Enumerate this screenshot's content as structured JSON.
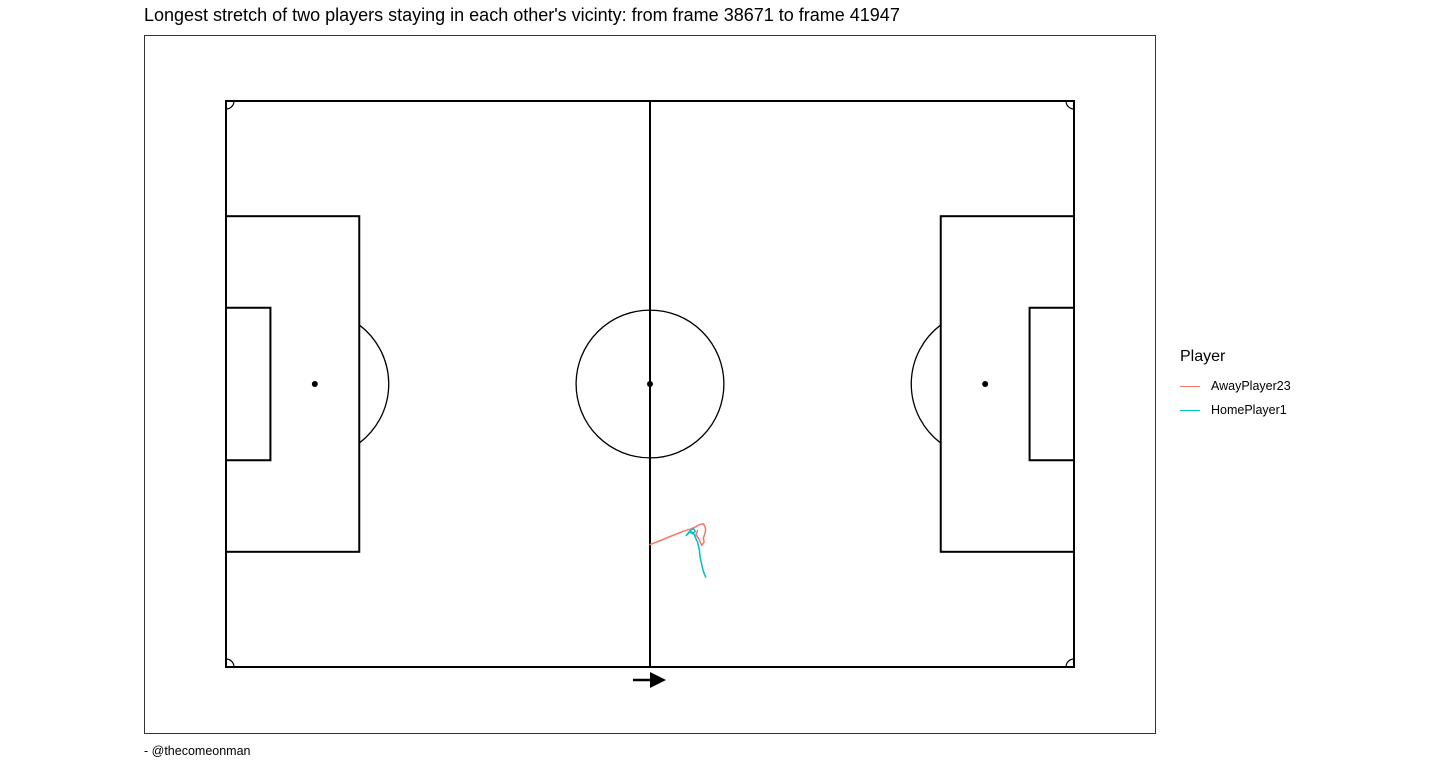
{
  "title": "Longest stretch of two players staying in each other's vicinty: from frame 38671 to frame 41947",
  "caption": "- @thecomeonman",
  "legend": {
    "title": "Player",
    "items": [
      {
        "label": "AwayPlayer23",
        "color": "#F8766D"
      },
      {
        "label": "HomePlayer1",
        "color": "#00BFC4"
      }
    ]
  },
  "chart_data": {
    "type": "line",
    "pitch": {
      "length": 105,
      "width": 68,
      "attack_direction": "right"
    },
    "xlim": [
      -10,
      115
    ],
    "ylim": [
      -8,
      76
    ],
    "grid": false,
    "legend_position": "right",
    "series": [
      {
        "name": "AwayPlayer23",
        "color": "#F8766D",
        "x": [
          52.5,
          53.8,
          55.3,
          56.6,
          57.6,
          58.3,
          58.6,
          59.1,
          59.3,
          59.4,
          59.3,
          59.1,
          59.2,
          58.9,
          58.6,
          58.2,
          58.4
        ],
        "y": [
          14.7,
          15.2,
          15.8,
          16.3,
          16.6,
          16.9,
          17.1,
          17.2,
          16.9,
          16.5,
          16.0,
          15.5,
          15.0,
          14.6,
          15.3,
          15.9,
          16.4
        ]
      },
      {
        "name": "HomePlayer1",
        "color": "#00BFC4",
        "x": [
          59.4,
          59.1,
          58.9,
          58.7,
          58.6,
          58.4,
          58.2,
          58.0,
          57.7,
          57.4,
          57.0,
          57.3,
          57.6,
          57.9,
          58.1,
          57.8,
          57.5
        ],
        "y": [
          10.8,
          11.5,
          12.3,
          13.2,
          14.1,
          15.0,
          15.4,
          15.9,
          16.2,
          16.3,
          15.8,
          16.1,
          16.5,
          16.6,
          16.3,
          16.0,
          16.2
        ]
      }
    ]
  }
}
